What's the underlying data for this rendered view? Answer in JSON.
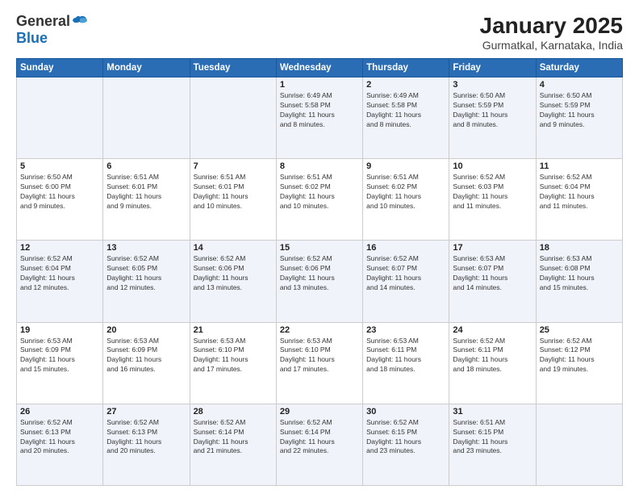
{
  "header": {
    "logo_general": "General",
    "logo_blue": "Blue",
    "month_year": "January 2025",
    "location": "Gurmatkal, Karnataka, India"
  },
  "weekdays": [
    "Sunday",
    "Monday",
    "Tuesday",
    "Wednesday",
    "Thursday",
    "Friday",
    "Saturday"
  ],
  "weeks": [
    [
      {
        "day": "",
        "info": ""
      },
      {
        "day": "",
        "info": ""
      },
      {
        "day": "",
        "info": ""
      },
      {
        "day": "1",
        "info": "Sunrise: 6:49 AM\nSunset: 5:58 PM\nDaylight: 11 hours\nand 8 minutes."
      },
      {
        "day": "2",
        "info": "Sunrise: 6:49 AM\nSunset: 5:58 PM\nDaylight: 11 hours\nand 8 minutes."
      },
      {
        "day": "3",
        "info": "Sunrise: 6:50 AM\nSunset: 5:59 PM\nDaylight: 11 hours\nand 8 minutes."
      },
      {
        "day": "4",
        "info": "Sunrise: 6:50 AM\nSunset: 5:59 PM\nDaylight: 11 hours\nand 9 minutes."
      }
    ],
    [
      {
        "day": "5",
        "info": "Sunrise: 6:50 AM\nSunset: 6:00 PM\nDaylight: 11 hours\nand 9 minutes."
      },
      {
        "day": "6",
        "info": "Sunrise: 6:51 AM\nSunset: 6:01 PM\nDaylight: 11 hours\nand 9 minutes."
      },
      {
        "day": "7",
        "info": "Sunrise: 6:51 AM\nSunset: 6:01 PM\nDaylight: 11 hours\nand 10 minutes."
      },
      {
        "day": "8",
        "info": "Sunrise: 6:51 AM\nSunset: 6:02 PM\nDaylight: 11 hours\nand 10 minutes."
      },
      {
        "day": "9",
        "info": "Sunrise: 6:51 AM\nSunset: 6:02 PM\nDaylight: 11 hours\nand 10 minutes."
      },
      {
        "day": "10",
        "info": "Sunrise: 6:52 AM\nSunset: 6:03 PM\nDaylight: 11 hours\nand 11 minutes."
      },
      {
        "day": "11",
        "info": "Sunrise: 6:52 AM\nSunset: 6:04 PM\nDaylight: 11 hours\nand 11 minutes."
      }
    ],
    [
      {
        "day": "12",
        "info": "Sunrise: 6:52 AM\nSunset: 6:04 PM\nDaylight: 11 hours\nand 12 minutes."
      },
      {
        "day": "13",
        "info": "Sunrise: 6:52 AM\nSunset: 6:05 PM\nDaylight: 11 hours\nand 12 minutes."
      },
      {
        "day": "14",
        "info": "Sunrise: 6:52 AM\nSunset: 6:06 PM\nDaylight: 11 hours\nand 13 minutes."
      },
      {
        "day": "15",
        "info": "Sunrise: 6:52 AM\nSunset: 6:06 PM\nDaylight: 11 hours\nand 13 minutes."
      },
      {
        "day": "16",
        "info": "Sunrise: 6:52 AM\nSunset: 6:07 PM\nDaylight: 11 hours\nand 14 minutes."
      },
      {
        "day": "17",
        "info": "Sunrise: 6:53 AM\nSunset: 6:07 PM\nDaylight: 11 hours\nand 14 minutes."
      },
      {
        "day": "18",
        "info": "Sunrise: 6:53 AM\nSunset: 6:08 PM\nDaylight: 11 hours\nand 15 minutes."
      }
    ],
    [
      {
        "day": "19",
        "info": "Sunrise: 6:53 AM\nSunset: 6:09 PM\nDaylight: 11 hours\nand 15 minutes."
      },
      {
        "day": "20",
        "info": "Sunrise: 6:53 AM\nSunset: 6:09 PM\nDaylight: 11 hours\nand 16 minutes."
      },
      {
        "day": "21",
        "info": "Sunrise: 6:53 AM\nSunset: 6:10 PM\nDaylight: 11 hours\nand 17 minutes."
      },
      {
        "day": "22",
        "info": "Sunrise: 6:53 AM\nSunset: 6:10 PM\nDaylight: 11 hours\nand 17 minutes."
      },
      {
        "day": "23",
        "info": "Sunrise: 6:53 AM\nSunset: 6:11 PM\nDaylight: 11 hours\nand 18 minutes."
      },
      {
        "day": "24",
        "info": "Sunrise: 6:52 AM\nSunset: 6:11 PM\nDaylight: 11 hours\nand 18 minutes."
      },
      {
        "day": "25",
        "info": "Sunrise: 6:52 AM\nSunset: 6:12 PM\nDaylight: 11 hours\nand 19 minutes."
      }
    ],
    [
      {
        "day": "26",
        "info": "Sunrise: 6:52 AM\nSunset: 6:13 PM\nDaylight: 11 hours\nand 20 minutes."
      },
      {
        "day": "27",
        "info": "Sunrise: 6:52 AM\nSunset: 6:13 PM\nDaylight: 11 hours\nand 20 minutes."
      },
      {
        "day": "28",
        "info": "Sunrise: 6:52 AM\nSunset: 6:14 PM\nDaylight: 11 hours\nand 21 minutes."
      },
      {
        "day": "29",
        "info": "Sunrise: 6:52 AM\nSunset: 6:14 PM\nDaylight: 11 hours\nand 22 minutes."
      },
      {
        "day": "30",
        "info": "Sunrise: 6:52 AM\nSunset: 6:15 PM\nDaylight: 11 hours\nand 23 minutes."
      },
      {
        "day": "31",
        "info": "Sunrise: 6:51 AM\nSunset: 6:15 PM\nDaylight: 11 hours\nand 23 minutes."
      },
      {
        "day": "",
        "info": ""
      }
    ]
  ]
}
